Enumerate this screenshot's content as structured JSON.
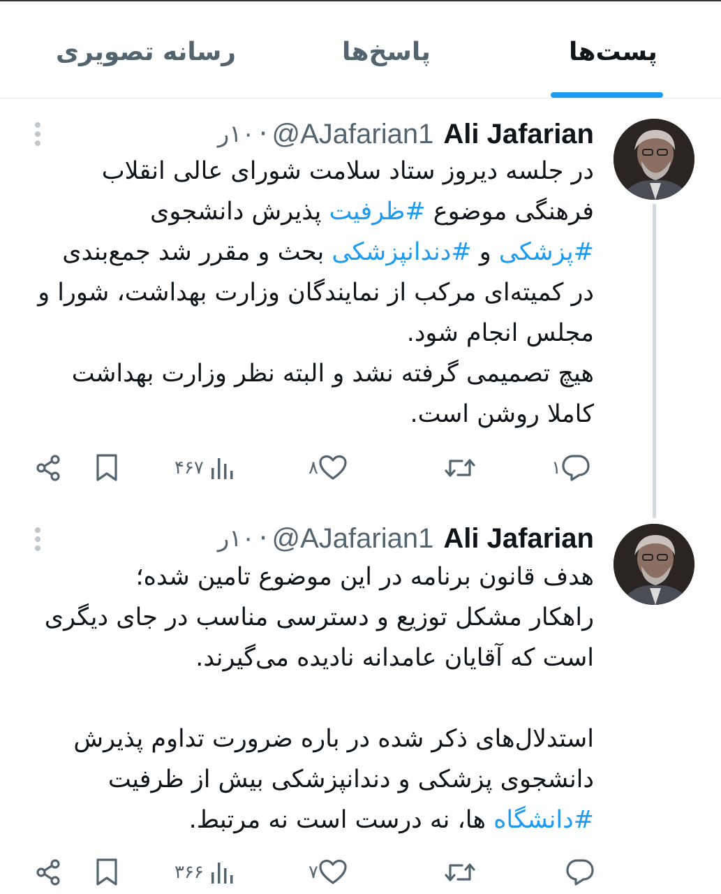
{
  "tabs": {
    "posts": "پست‌ها",
    "replies": "پاسخ‌ها",
    "media": "رسانه تصویری"
  },
  "colors": {
    "accent": "#1d9bf0",
    "text": "#0f1419",
    "secondary": "#536471"
  },
  "tweets": [
    {
      "name": "Ali Jafarian",
      "handle": "@AJafarian1",
      "time": "۱۰ر",
      "counts": {
        "replies": "۱",
        "retweets": "",
        "likes": "۸",
        "views": "۴۶۷"
      },
      "lines": [
        {
          "t1": "در جلسه دیروز ستاد سلامت شورای عالی انقلاب"
        },
        {
          "t1": "فرهنگی موضوع ",
          "tag1": "#ظرفیت",
          "t2": " پذیرش دانشجوی"
        },
        {
          "tag1": "#پزشکی",
          "t1": " و ",
          "tag2": "#دندانپزشکی",
          "t2": " بحث و مقرر شد جمع‌بندی"
        },
        {
          "t1": "در کمیته‌ای مرکب از نمایندگان وزارت بهداشت، شورا و"
        },
        {
          "t1": "مجلس انجام شود."
        },
        {
          "t1": "هیچ تصمیمی گرفته نشد و البته نظر وزارت بهداشت"
        },
        {
          "t1": "کاملا روشن است."
        }
      ]
    },
    {
      "name": "Ali Jafarian",
      "handle": "@AJafarian1",
      "time": "۱۰ر",
      "counts": {
        "replies": "",
        "retweets": "",
        "likes": "۷",
        "views": "۳۶۶"
      },
      "lines": [
        {
          "t1": "هدف قانون برنامه در این موضوع تامین شده؛"
        },
        {
          "t1": "راهکار مشکل توزیع و دسترسی مناسب در جای دیگری"
        },
        {
          "t1": "است که آقایان عامدانه نادیده می‌گیرند."
        },
        {
          "t1": "استدلال‌های ذکر شده در باره ضرورت تداوم پذیرش"
        },
        {
          "t1": "دانشجوی پزشکی و دندانپزشکی بیش از ظرفیت"
        },
        {
          "tag1": "#دانشگاه",
          "t1": " ها، نه درست است نه مرتبط."
        }
      ]
    }
  ]
}
